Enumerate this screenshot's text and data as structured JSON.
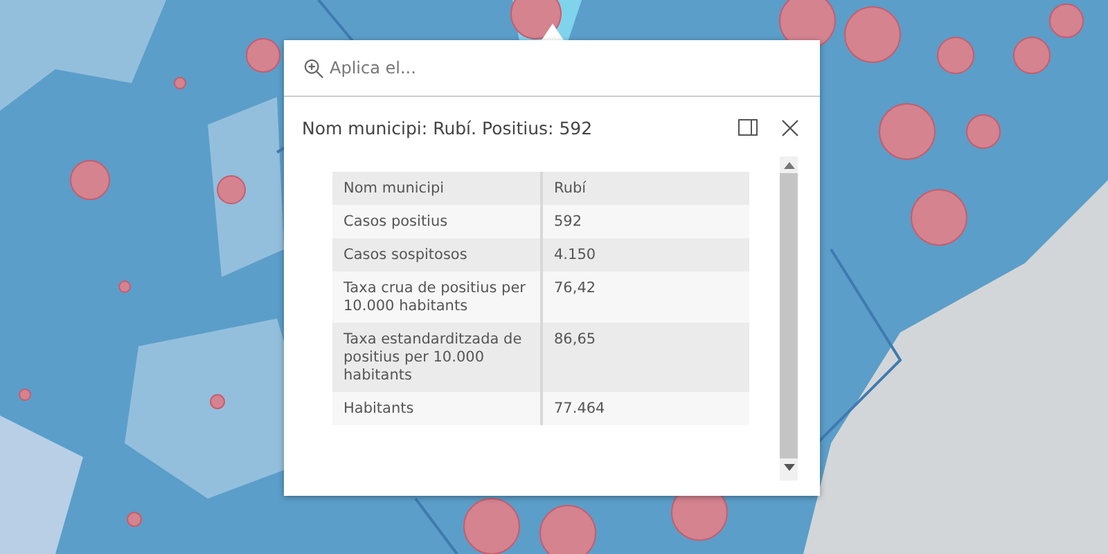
{
  "popup": {
    "search": {
      "placeholder": "Aplica el..."
    },
    "title": "Nom municipi: Rubí. Positius: 592",
    "table": {
      "rows": [
        {
          "field": "Nom municipi",
          "value": "Rubí"
        },
        {
          "field": "Casos positius",
          "value": "592"
        },
        {
          "field": "Casos sospitosos",
          "value": "4.150"
        },
        {
          "field": "Taxa crua de positius per 10.000 habitants",
          "value": "76,42"
        },
        {
          "field": "Taxa estandarditzada de positius per 10.000 habitants",
          "value": "86,65"
        },
        {
          "field": "Habitants",
          "value": "77.464"
        }
      ]
    }
  }
}
